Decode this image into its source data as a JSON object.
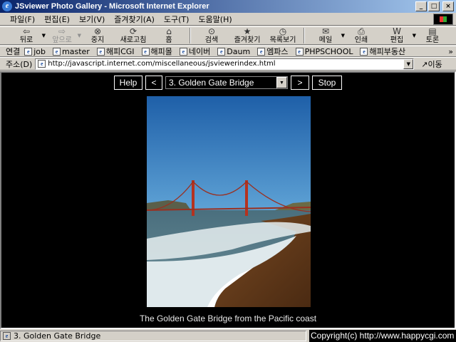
{
  "window": {
    "title": "JSviewer Photo Gallery - Microsoft Internet Explorer"
  },
  "menu": [
    "파일(F)",
    "편집(E)",
    "보기(V)",
    "즐겨찾기(A)",
    "도구(T)",
    "도움말(H)"
  ],
  "toolbar": {
    "back": "뒤로",
    "forward": "앞으로",
    "stop": "중지",
    "refresh": "새로고침",
    "home": "홈",
    "search": "검색",
    "favorites": "즐겨찾기",
    "history": "목록보기",
    "mail": "메일",
    "print": "인쇄",
    "edit": "편집",
    "discuss": "토론"
  },
  "links": {
    "label": "연결",
    "items": [
      "job",
      "master",
      "해피CGI",
      "해피몰",
      "네이버",
      "Daum",
      "엠파스",
      "PHPSCHOOL",
      "해피부동산"
    ],
    "more": "»"
  },
  "address": {
    "label": "주소(D)",
    "url": "http://javascript.internet.com/miscellaneous/jsviewerindex.html",
    "go": "이동"
  },
  "gallery": {
    "help": "Help",
    "prev": "<",
    "next": ">",
    "stop": "Stop",
    "selected": "3. Golden Gate Bridge",
    "caption": "The Golden Gate Bridge from the Pacific coast"
  },
  "status": {
    "text": "3. Golden Gate Bridge",
    "copyright": "Copyright(c) http://www.happycgi.com"
  }
}
